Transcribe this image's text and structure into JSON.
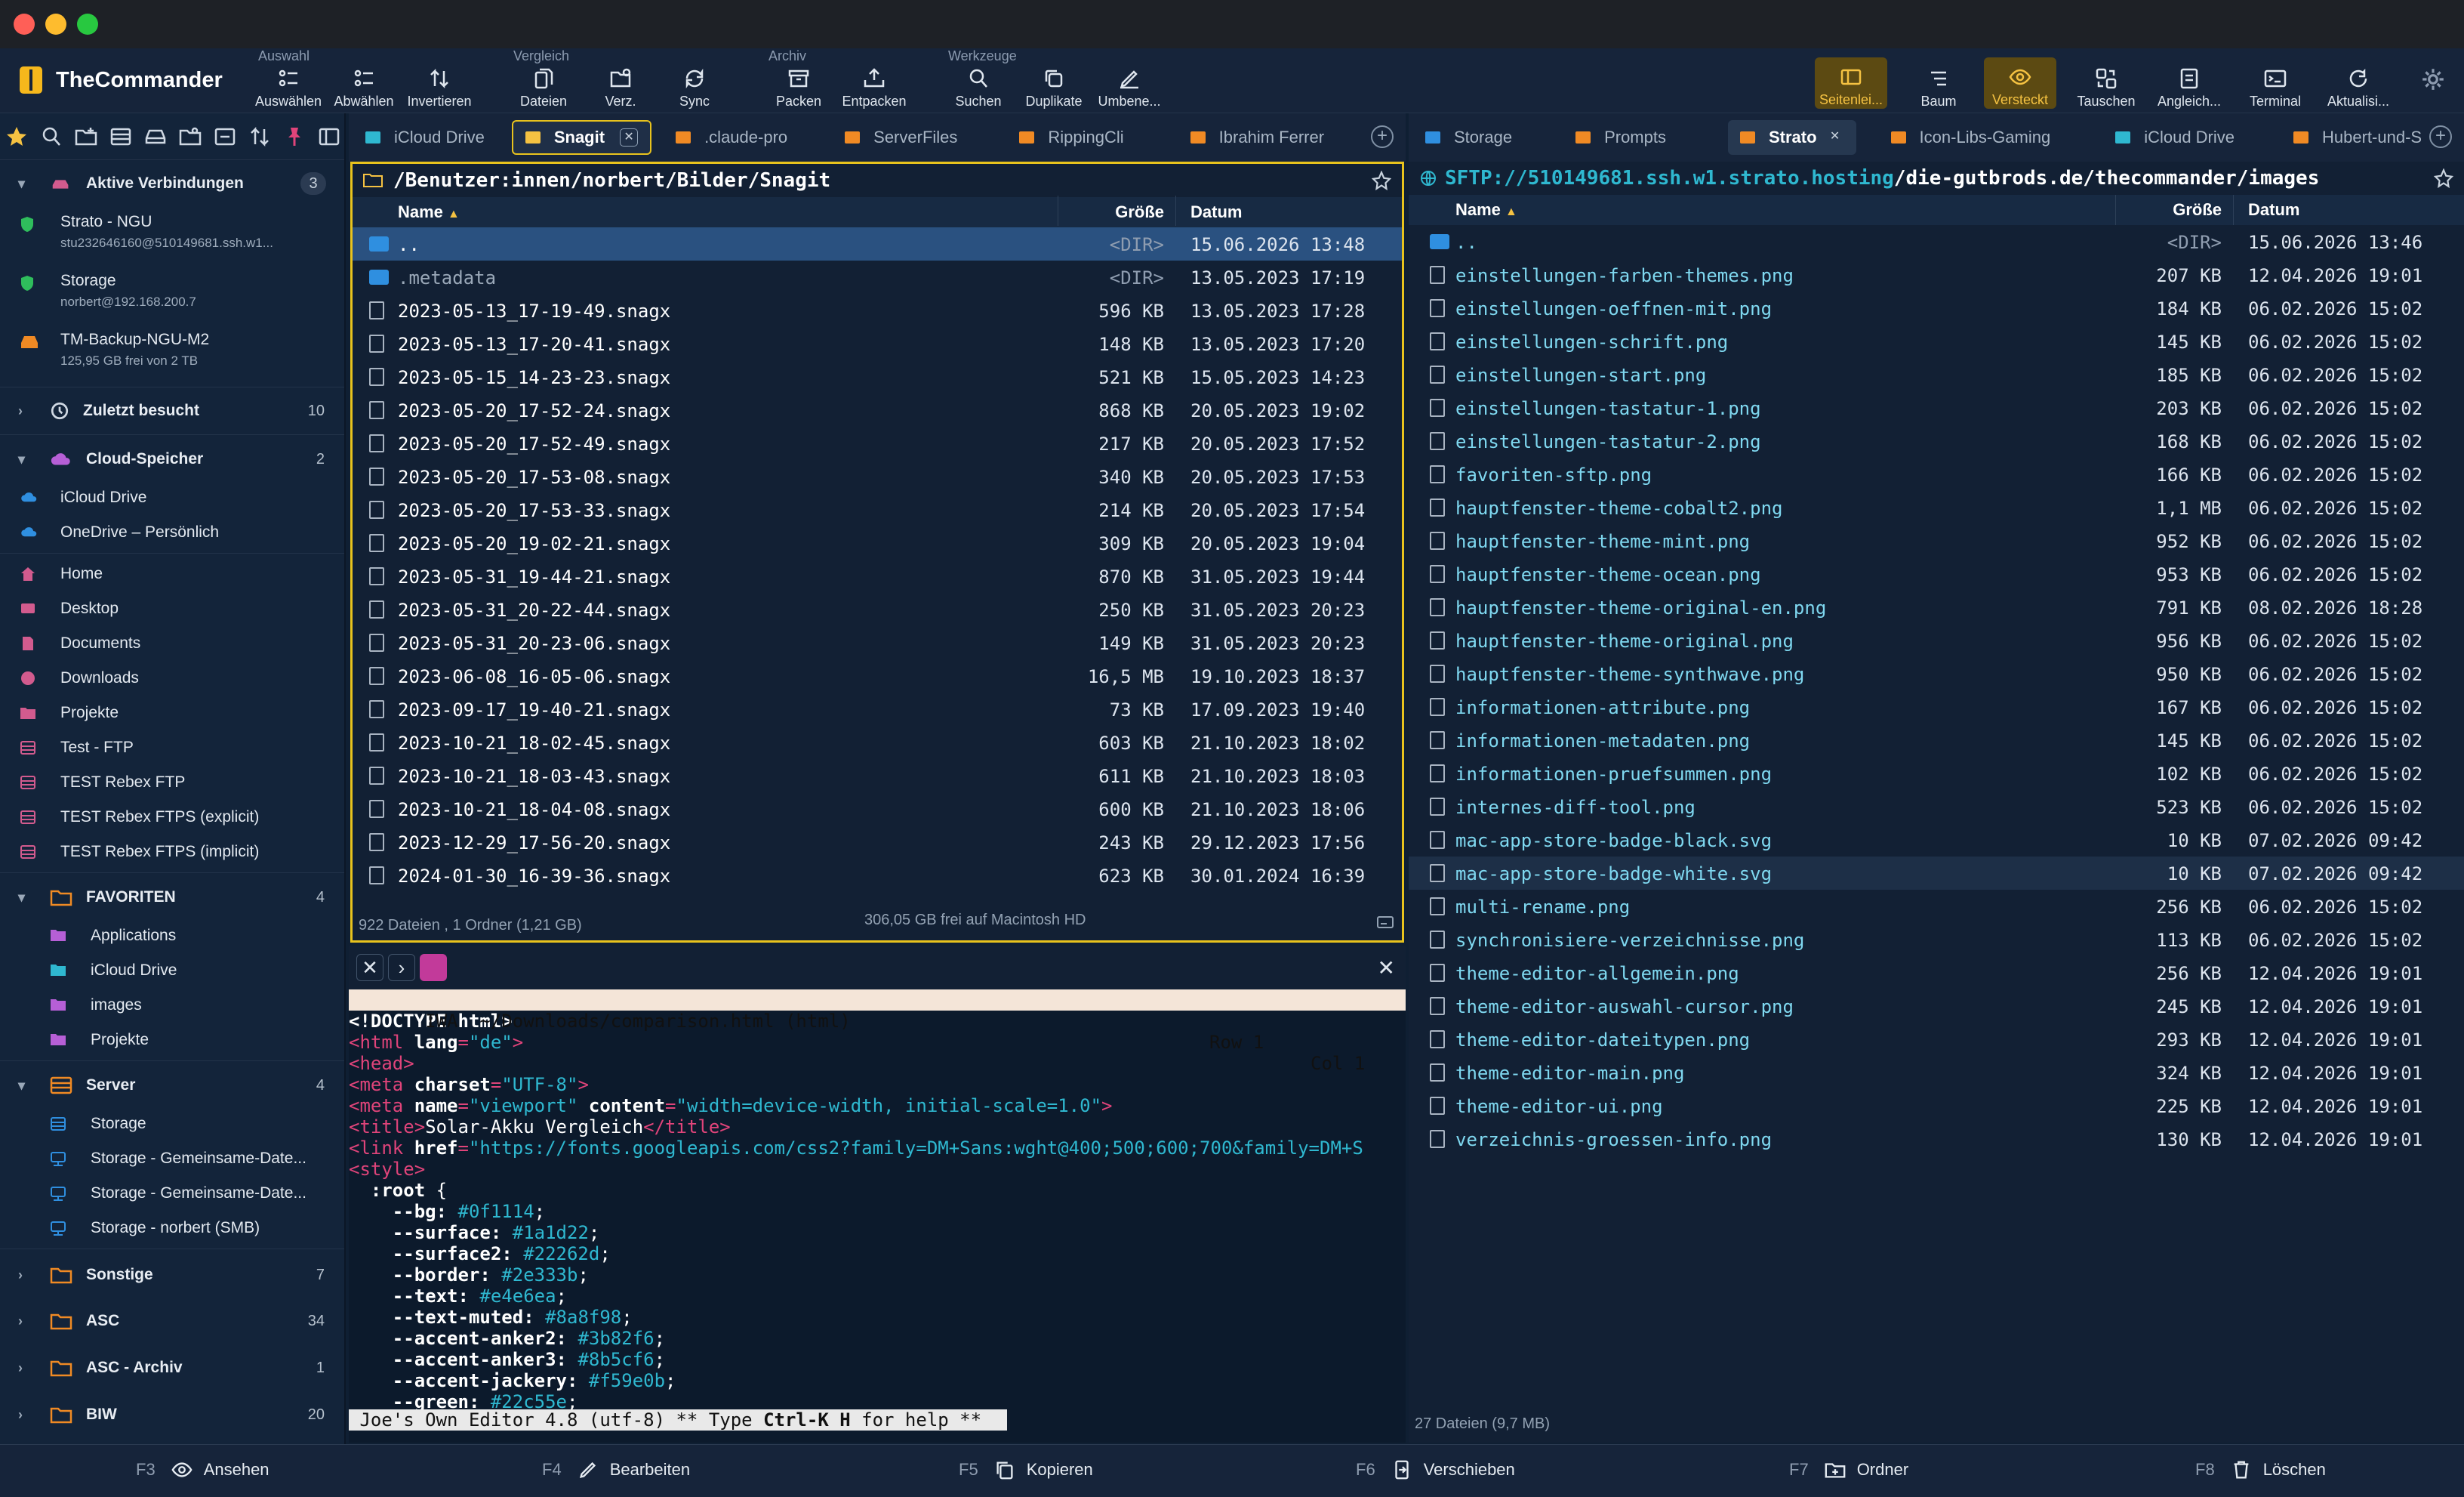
{
  "app": {
    "name": "TheCommander"
  },
  "toolbar": {
    "groups": {
      "auswahl": "Auswahl",
      "vergleich": "Vergleich",
      "archiv": "Archiv",
      "werkzeuge": "Werkzeuge"
    },
    "auswaehlen": "Auswählen",
    "abwaehlen": "Abwählen",
    "invertieren": "Invertieren",
    "dateien": "Dateien",
    "verz": "Verz.",
    "sync": "Sync",
    "packen": "Packen",
    "entpacken": "Entpacken",
    "suchen": "Suchen",
    "duplikate": "Duplikate",
    "umbenennen": "Umbene...",
    "seitenleiste": "Seitenlei...",
    "baum": "Baum",
    "versteckt": "Versteckt",
    "tauschen": "Tauschen",
    "angleichen": "Angleich...",
    "terminal": "Terminal",
    "aktualisieren": "Aktualisi..."
  },
  "sidebar": {
    "aktive": {
      "label": "Aktive Verbindungen",
      "count": "3"
    },
    "connections": [
      {
        "name": "Strato - NGU",
        "sub": "stu232646160@510149681.ssh.w1..."
      },
      {
        "name": "Storage",
        "sub": "norbert@192.168.200.7"
      },
      {
        "name": "TM-Backup-NGU-M2",
        "sub": "125,95 GB frei von 2 TB"
      }
    ],
    "zuletzt": {
      "label": "Zuletzt besucht",
      "count": "10"
    },
    "cloud": {
      "label": "Cloud-Speicher",
      "count": "2"
    },
    "cloud_items": [
      "iCloud Drive",
      "OneDrive – Persönlich"
    ],
    "places": [
      "Home",
      "Desktop",
      "Documents",
      "Downloads",
      "Projekte",
      "Test - FTP",
      "TEST Rebex FTP",
      "TEST Rebex FTPS (explicit)",
      "TEST Rebex FTPS (implicit)"
    ],
    "favoriten": {
      "label": "FAVORITEN",
      "count": "4"
    },
    "fav_items": [
      "Applications",
      "iCloud Drive",
      "images",
      "Projekte"
    ],
    "server": {
      "label": "Server",
      "count": "4"
    },
    "server_items": [
      "Storage",
      "Storage - Gemeinsame-Date...",
      "Storage - Gemeinsame-Date...",
      "Storage - norbert (SMB)"
    ],
    "sonstige": {
      "label": "Sonstige",
      "count": "7"
    },
    "asc": {
      "label": "ASC",
      "count": "34"
    },
    "ascarchiv": {
      "label": "ASC - Archiv",
      "count": "1"
    },
    "biw": {
      "label": "BIW",
      "count": "20"
    }
  },
  "left": {
    "tabs": [
      "iCloud Drive",
      "Snagit",
      ".claude-pro",
      "ServerFiles",
      "RippingCli",
      "Ibrahim Ferrer"
    ],
    "path": "/Benutzer:innen/norbert/Bilder/Snagit",
    "cols": {
      "name": "Name",
      "size": "Größe",
      "date": "Datum"
    },
    "rows": [
      {
        "name": "..",
        "size": "<DIR>",
        "date": "15.06.2026 13:48",
        "dir": true
      },
      {
        "name": ".metadata",
        "size": "<DIR>",
        "date": "13.05.2023 17:19",
        "dir": true
      },
      {
        "name": "2023-05-13_17-19-49.snagx",
        "size": "596 KB",
        "date": "13.05.2023 17:28"
      },
      {
        "name": "2023-05-13_17-20-41.snagx",
        "size": "148 KB",
        "date": "13.05.2023 17:20"
      },
      {
        "name": "2023-05-15_14-23-23.snagx",
        "size": "521 KB",
        "date": "15.05.2023 14:23"
      },
      {
        "name": "2023-05-20_17-52-24.snagx",
        "size": "868 KB",
        "date": "20.05.2023 19:02"
      },
      {
        "name": "2023-05-20_17-52-49.snagx",
        "size": "217 KB",
        "date": "20.05.2023 17:52"
      },
      {
        "name": "2023-05-20_17-53-08.snagx",
        "size": "340 KB",
        "date": "20.05.2023 17:53"
      },
      {
        "name": "2023-05-20_17-53-33.snagx",
        "size": "214 KB",
        "date": "20.05.2023 17:54"
      },
      {
        "name": "2023-05-20_19-02-21.snagx",
        "size": "309 KB",
        "date": "20.05.2023 19:04"
      },
      {
        "name": "2023-05-31_19-44-21.snagx",
        "size": "870 KB",
        "date": "31.05.2023 19:44"
      },
      {
        "name": "2023-05-31_20-22-44.snagx",
        "size": "250 KB",
        "date": "31.05.2023 20:23"
      },
      {
        "name": "2023-05-31_20-23-06.snagx",
        "size": "149 KB",
        "date": "31.05.2023 20:23"
      },
      {
        "name": "2023-06-08_16-05-06.snagx",
        "size": "16,5 MB",
        "date": "19.10.2023 18:37"
      },
      {
        "name": "2023-09-17_19-40-21.snagx",
        "size": "73 KB",
        "date": "17.09.2023 19:40"
      },
      {
        "name": "2023-10-21_18-02-45.snagx",
        "size": "603 KB",
        "date": "21.10.2023 18:02"
      },
      {
        "name": "2023-10-21_18-03-43.snagx",
        "size": "611 KB",
        "date": "21.10.2023 18:03"
      },
      {
        "name": "2023-10-21_18-04-08.snagx",
        "size": "600 KB",
        "date": "21.10.2023 18:06"
      },
      {
        "name": "2023-12-29_17-56-20.snagx",
        "size": "243 KB",
        "date": "29.12.2023 17:56"
      },
      {
        "name": "2024-01-30_16-39-36.snagx",
        "size": "623 KB",
        "date": "30.01.2024 16:39"
      }
    ],
    "status": "922 Dateien , 1 Ordner (1,21 GB)",
    "free": "306,05 GB frei auf Macintosh HD"
  },
  "editor": {
    "status": "   IWA  ~/Downloads/comparison.html (html)",
    "row": "Row 1",
    "col": "Col 1",
    "lines": [
      [
        {
          "t": "<!DOCTYPE html>",
          "c": "#ffffff",
          "b": true
        }
      ],
      [
        {
          "t": "<html ",
          "c": "#e0447a"
        },
        {
          "t": "lang",
          "c": "#ffffff",
          "b": true
        },
        {
          "t": "=",
          "c": "#e0447a"
        },
        {
          "t": "\"de\"",
          "c": "#2fb8d0"
        },
        {
          "t": ">",
          "c": "#e0447a"
        }
      ],
      [
        {
          "t": "<head>",
          "c": "#e0447a"
        }
      ],
      [
        {
          "t": "<meta ",
          "c": "#e0447a"
        },
        {
          "t": "charset",
          "c": "#ffffff",
          "b": true
        },
        {
          "t": "=",
          "c": "#e0447a"
        },
        {
          "t": "\"UTF-8\"",
          "c": "#2fb8d0"
        },
        {
          "t": ">",
          "c": "#e0447a"
        }
      ],
      [
        {
          "t": "<meta ",
          "c": "#e0447a"
        },
        {
          "t": "name",
          "c": "#ffffff",
          "b": true
        },
        {
          "t": "=",
          "c": "#e0447a"
        },
        {
          "t": "\"viewport\"",
          "c": "#2fb8d0"
        },
        {
          "t": " content",
          "c": "#ffffff",
          "b": true
        },
        {
          "t": "=",
          "c": "#e0447a"
        },
        {
          "t": "\"width=device-width, initial-scale=1.0\"",
          "c": "#2fb8d0"
        },
        {
          "t": ">",
          "c": "#e0447a"
        }
      ],
      [
        {
          "t": "<title>",
          "c": "#e0447a"
        },
        {
          "t": "Solar-Akku Vergleich",
          "c": "#ffffff"
        },
        {
          "t": "</title>",
          "c": "#e0447a"
        }
      ],
      [
        {
          "t": "<link ",
          "c": "#e0447a"
        },
        {
          "t": "href",
          "c": "#ffffff",
          "b": true
        },
        {
          "t": "=",
          "c": "#e0447a"
        },
        {
          "t": "\"https://fonts.googleapis.com/css2?family=DM+Sans:wght@400;500;600;700&family=DM+S",
          "c": "#2fb8d0"
        }
      ],
      [
        {
          "t": "<style>",
          "c": "#e0447a"
        }
      ],
      [
        {
          "t": "  :root ",
          "c": "#ffffff",
          "b": true
        },
        {
          "t": "{",
          "c": "#ffffff"
        }
      ],
      [
        {
          "t": "    --bg: ",
          "c": "#ffffff",
          "b": true
        },
        {
          "t": "#0f1114",
          "c": "#2fb8d0"
        },
        {
          "t": ";",
          "c": "#ffffff"
        }
      ],
      [
        {
          "t": "    --surface: ",
          "c": "#ffffff",
          "b": true
        },
        {
          "t": "#1a1d22",
          "c": "#2fb8d0"
        },
        {
          "t": ";",
          "c": "#ffffff"
        }
      ],
      [
        {
          "t": "    --surface2: ",
          "c": "#ffffff",
          "b": true
        },
        {
          "t": "#22262d",
          "c": "#2fb8d0"
        },
        {
          "t": ";",
          "c": "#ffffff"
        }
      ],
      [
        {
          "t": "    --border: ",
          "c": "#ffffff",
          "b": true
        },
        {
          "t": "#2e333b",
          "c": "#2fb8d0"
        },
        {
          "t": ";",
          "c": "#ffffff"
        }
      ],
      [
        {
          "t": "    --text: ",
          "c": "#ffffff",
          "b": true
        },
        {
          "t": "#e4e6ea",
          "c": "#2fb8d0"
        },
        {
          "t": ";",
          "c": "#ffffff"
        }
      ],
      [
        {
          "t": "    --text-muted: ",
          "c": "#ffffff",
          "b": true
        },
        {
          "t": "#8a8f98",
          "c": "#2fb8d0"
        },
        {
          "t": ";",
          "c": "#ffffff"
        }
      ],
      [
        {
          "t": "    --accent-anker2: ",
          "c": "#ffffff",
          "b": true
        },
        {
          "t": "#3b82f6",
          "c": "#2fb8d0"
        },
        {
          "t": ";",
          "c": "#ffffff"
        }
      ],
      [
        {
          "t": "    --accent-anker3: ",
          "c": "#ffffff",
          "b": true
        },
        {
          "t": "#8b5cf6",
          "c": "#2fb8d0"
        },
        {
          "t": ";",
          "c": "#ffffff"
        }
      ],
      [
        {
          "t": "    --accent-jackery: ",
          "c": "#ffffff",
          "b": true
        },
        {
          "t": "#f59e0b",
          "c": "#2fb8d0"
        },
        {
          "t": ";",
          "c": "#ffffff"
        }
      ],
      [
        {
          "t": "    --green: ",
          "c": "#ffffff",
          "b": true
        },
        {
          "t": "#22c55e",
          "c": "#2fb8d0"
        },
        {
          "t": ";",
          "c": "#ffffff"
        }
      ]
    ],
    "help_pre": " Joe's Own Editor 4.8 (utf-8) ** Type ",
    "help_key": "Ctrl-K H",
    "help_post": " for help **"
  },
  "right": {
    "tabs": [
      "Storage",
      "Prompts",
      "Strato",
      "Icon-Libs-Gaming",
      "iCloud Drive",
      "Hubert-und-S"
    ],
    "path_host": "SFTP://510149681.ssh.w1.strato.hosting",
    "path_rest": "/die-gutbrods.de/thecommander/images",
    "cols": {
      "name": "Name",
      "size": "Größe",
      "date": "Datum"
    },
    "rows": [
      {
        "name": "..",
        "size": "<DIR>",
        "date": "15.06.2026 13:46",
        "dir": true
      },
      {
        "name": "einstellungen-farben-themes.png",
        "size": "207 KB",
        "date": "12.04.2026 19:01"
      },
      {
        "name": "einstellungen-oeffnen-mit.png",
        "size": "184 KB",
        "date": "06.02.2026 15:02"
      },
      {
        "name": "einstellungen-schrift.png",
        "size": "145 KB",
        "date": "06.02.2026 15:02"
      },
      {
        "name": "einstellungen-start.png",
        "size": "185 KB",
        "date": "06.02.2026 15:02"
      },
      {
        "name": "einstellungen-tastatur-1.png",
        "size": "203 KB",
        "date": "06.02.2026 15:02"
      },
      {
        "name": "einstellungen-tastatur-2.png",
        "size": "168 KB",
        "date": "06.02.2026 15:02"
      },
      {
        "name": "favoriten-sftp.png",
        "size": "166 KB",
        "date": "06.02.2026 15:02"
      },
      {
        "name": "hauptfenster-theme-cobalt2.png",
        "size": "1,1 MB",
        "date": "06.02.2026 15:02"
      },
      {
        "name": "hauptfenster-theme-mint.png",
        "size": "952 KB",
        "date": "06.02.2026 15:02"
      },
      {
        "name": "hauptfenster-theme-ocean.png",
        "size": "953 KB",
        "date": "06.02.2026 15:02"
      },
      {
        "name": "hauptfenster-theme-original-en.png",
        "size": "791 KB",
        "date": "08.02.2026 18:28"
      },
      {
        "name": "hauptfenster-theme-original.png",
        "size": "956 KB",
        "date": "06.02.2026 15:02"
      },
      {
        "name": "hauptfenster-theme-synthwave.png",
        "size": "950 KB",
        "date": "06.02.2026 15:02"
      },
      {
        "name": "informationen-attribute.png",
        "size": "167 KB",
        "date": "06.02.2026 15:02"
      },
      {
        "name": "informationen-metadaten.png",
        "size": "145 KB",
        "date": "06.02.2026 15:02"
      },
      {
        "name": "informationen-pruefsummen.png",
        "size": "102 KB",
        "date": "06.02.2026 15:02"
      },
      {
        "name": "internes-diff-tool.png",
        "size": "523 KB",
        "date": "06.02.2026 15:02"
      },
      {
        "name": "mac-app-store-badge-black.svg",
        "size": "10 KB",
        "date": "07.02.2026 09:42"
      },
      {
        "name": "mac-app-store-badge-white.svg",
        "size": "10 KB",
        "date": "07.02.2026 09:42"
      },
      {
        "name": "multi-rename.png",
        "size": "256 KB",
        "date": "06.02.2026 15:02"
      },
      {
        "name": "synchronisiere-verzeichnisse.png",
        "size": "113 KB",
        "date": "06.02.2026 15:02"
      },
      {
        "name": "theme-editor-allgemein.png",
        "size": "256 KB",
        "date": "12.04.2026 19:01"
      },
      {
        "name": "theme-editor-auswahl-cursor.png",
        "size": "245 KB",
        "date": "12.04.2026 19:01"
      },
      {
        "name": "theme-editor-dateitypen.png",
        "size": "293 KB",
        "date": "12.04.2026 19:01"
      },
      {
        "name": "theme-editor-main.png",
        "size": "324 KB",
        "date": "12.04.2026 19:01"
      },
      {
        "name": "theme-editor-ui.png",
        "size": "225 KB",
        "date": "12.04.2026 19:01"
      },
      {
        "name": "verzeichnis-groessen-info.png",
        "size": "130 KB",
        "date": "12.04.2026 19:01"
      }
    ],
    "status": "27 Dateien  (9,7 MB)"
  },
  "fkeys": [
    {
      "key": "F3",
      "label": "Ansehen",
      "icon": "eye-icon"
    },
    {
      "key": "F4",
      "label": "Bearbeiten",
      "icon": "pencil-icon"
    },
    {
      "key": "F5",
      "label": "Kopieren",
      "icon": "copy-icon"
    },
    {
      "key": "F6",
      "label": "Verschieben",
      "icon": "move-icon"
    },
    {
      "key": "F7",
      "label": "Ordner",
      "icon": "new-folder-icon"
    },
    {
      "key": "F8",
      "label": "Löschen",
      "icon": "trash-icon"
    }
  ],
  "colors": {
    "accent": "#e8c31d",
    "brand": "#f6b81c",
    "selection": "#2a5180",
    "background": "#0f1f33"
  }
}
